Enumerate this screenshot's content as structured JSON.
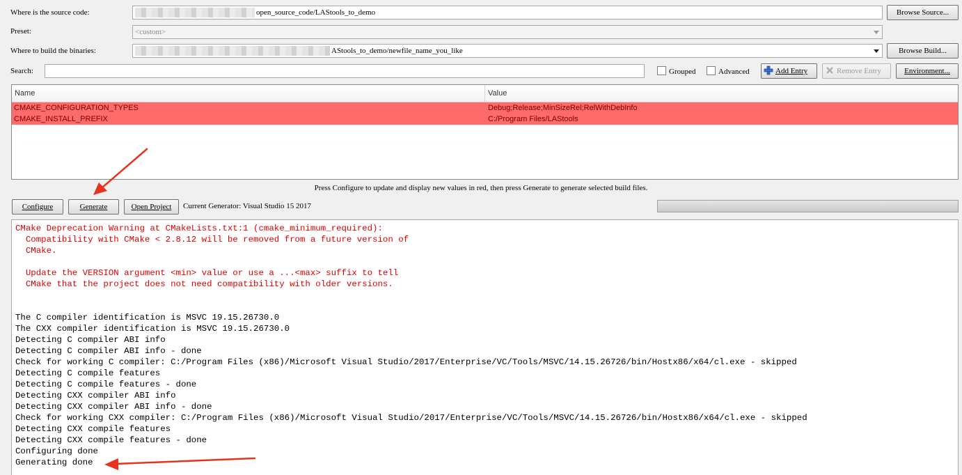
{
  "source": {
    "label": "Where is the source code:",
    "value_suffix": "open_source_code/LAStools_to_demo",
    "browse_label": "Browse Source..."
  },
  "preset": {
    "label": "Preset:",
    "value": "<custom>"
  },
  "build": {
    "label": "Where to build the binaries:",
    "value_suffix": "AStools_to_demo/newfile_name_you_like",
    "browse_label": "Browse Build..."
  },
  "search": {
    "label": "Search:",
    "value": "",
    "grouped_label": "Grouped",
    "advanced_label": "Advanced",
    "add_entry_label": "Add Entry",
    "remove_entry_label": "Remove Entry",
    "environment_label": "Environment..."
  },
  "table": {
    "col_name": "Name",
    "col_value": "Value",
    "rows": [
      {
        "name": "CMAKE_CONFIGURATION_TYPES",
        "value": "Debug;Release;MinSizeRel;RelWithDebInfo"
      },
      {
        "name": "CMAKE_INSTALL_PREFIX",
        "value": "C:/Program Files/LAStools"
      }
    ]
  },
  "hint": "Press Configure to update and display new values in red, then press Generate to generate selected build files.",
  "actions": {
    "configure_label": "Configure",
    "generate_label": "Generate",
    "open_project_label": "Open Project",
    "generator_text": "Current Generator: Visual Studio 15 2017"
  },
  "output": {
    "lines": [
      {
        "text": "CMake Deprecation Warning at CMakeLists.txt:1 (cmake_minimum_required):",
        "red": true
      },
      {
        "text": "  Compatibility with CMake < 2.8.12 will be removed from a future version of",
        "red": true
      },
      {
        "text": "  CMake.",
        "red": true
      },
      {
        "text": "",
        "red": true
      },
      {
        "text": "  Update the VERSION argument <min> value or use a ...<max> suffix to tell",
        "red": true
      },
      {
        "text": "  CMake that the project does not need compatibility with older versions.",
        "red": true
      },
      {
        "text": "",
        "red": false
      },
      {
        "text": "",
        "red": false
      },
      {
        "text": "The C compiler identification is MSVC 19.15.26730.0",
        "red": false
      },
      {
        "text": "The CXX compiler identification is MSVC 19.15.26730.0",
        "red": false
      },
      {
        "text": "Detecting C compiler ABI info",
        "red": false
      },
      {
        "text": "Detecting C compiler ABI info - done",
        "red": false
      },
      {
        "text": "Check for working C compiler: C:/Program Files (x86)/Microsoft Visual Studio/2017/Enterprise/VC/Tools/MSVC/14.15.26726/bin/Hostx86/x64/cl.exe - skipped",
        "red": false
      },
      {
        "text": "Detecting C compile features",
        "red": false
      },
      {
        "text": "Detecting C compile features - done",
        "red": false
      },
      {
        "text": "Detecting CXX compiler ABI info",
        "red": false
      },
      {
        "text": "Detecting CXX compiler ABI info - done",
        "red": false
      },
      {
        "text": "Check for working CXX compiler: C:/Program Files (x86)/Microsoft Visual Studio/2017/Enterprise/VC/Tools/MSVC/14.15.26726/bin/Hostx86/x64/cl.exe - skipped",
        "red": false
      },
      {
        "text": "Detecting CXX compile features",
        "red": false
      },
      {
        "text": "Detecting CXX compile features - done",
        "red": false
      },
      {
        "text": "Configuring done",
        "red": false
      },
      {
        "text": "Generating done",
        "red": false
      }
    ]
  },
  "colors": {
    "changed_row": "#ff6a6a",
    "warning_text": "#e00000",
    "annotation_arrow": "#e8321e"
  }
}
